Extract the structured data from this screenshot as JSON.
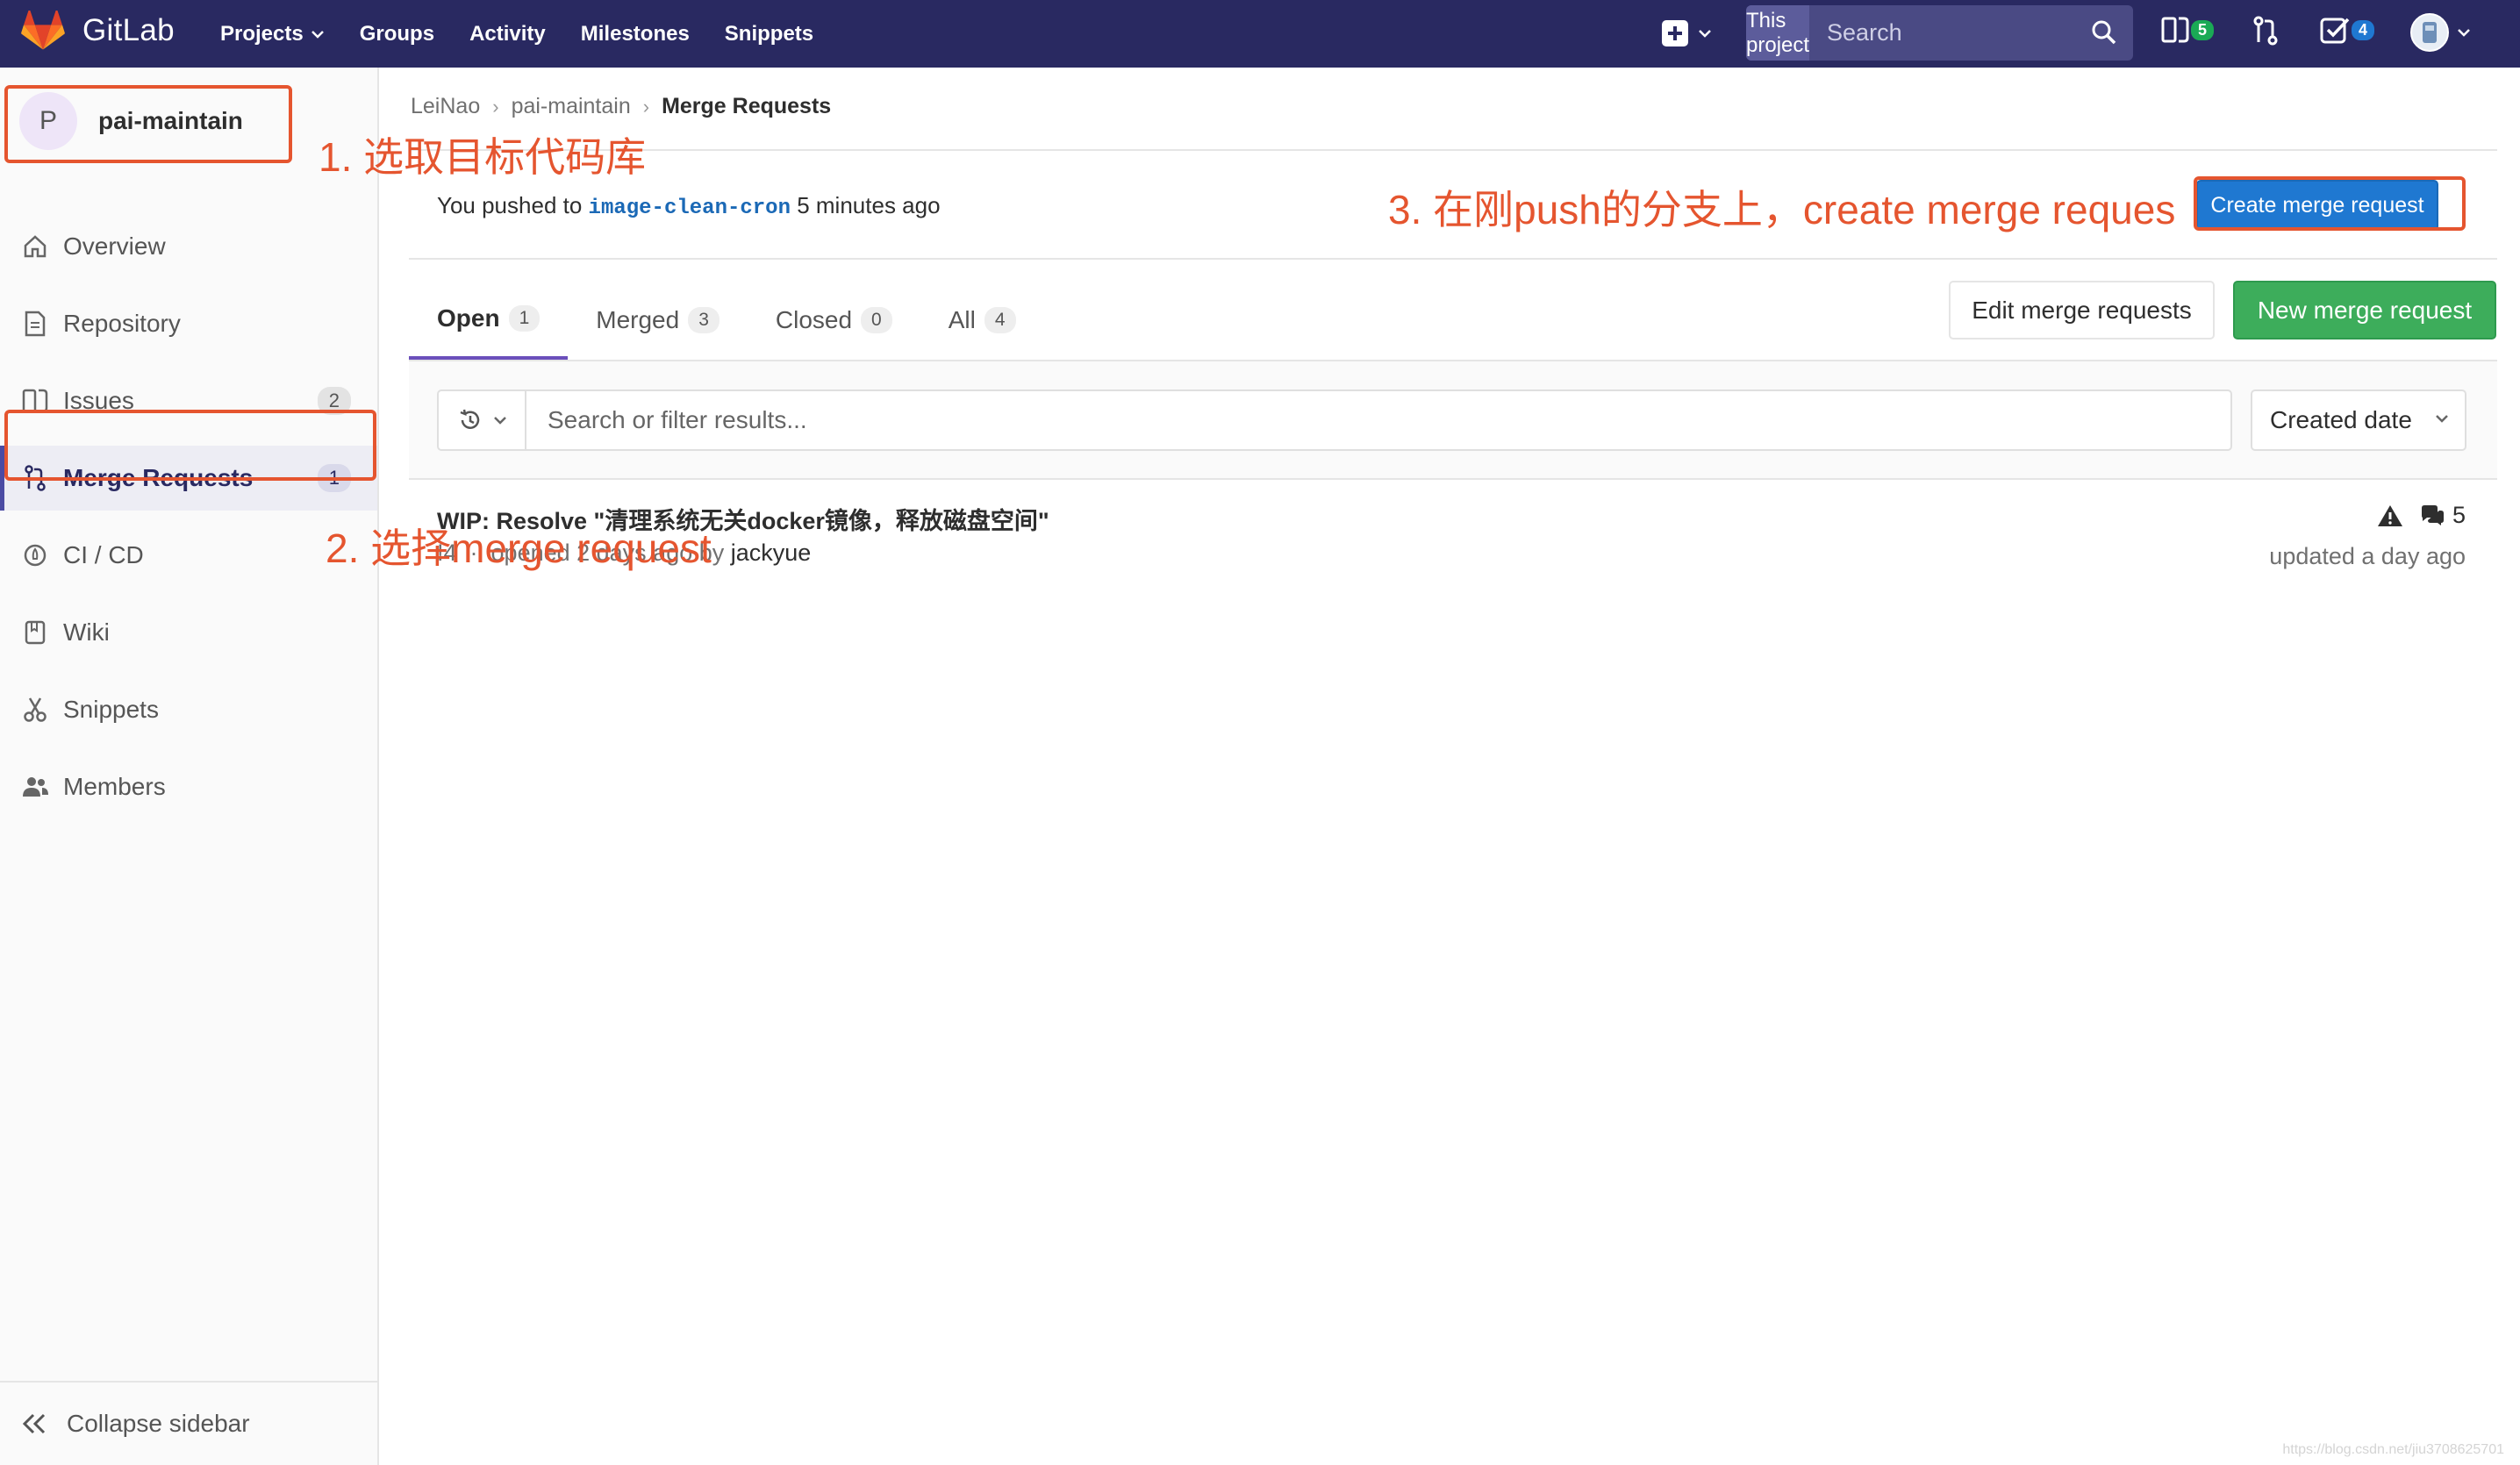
{
  "navbar": {
    "brand": "GitLab",
    "links": [
      "Projects",
      "Groups",
      "Activity",
      "Milestones",
      "Snippets"
    ],
    "search_scope": "This project",
    "search_placeholder": "Search",
    "issues_count": "5",
    "todos_count": "4",
    "bg_color": "#292961"
  },
  "sidebar": {
    "project_initial": "P",
    "project_name": "pai-maintain",
    "items": [
      {
        "label": "Overview",
        "icon": "home-icon"
      },
      {
        "label": "Repository",
        "icon": "doc-icon"
      },
      {
        "label": "Issues",
        "icon": "issues-icon",
        "count": "2"
      },
      {
        "label": "Merge Requests",
        "icon": "merge-request-icon",
        "count": "1",
        "active": true
      },
      {
        "label": "CI / CD",
        "icon": "rocket-icon"
      },
      {
        "label": "Wiki",
        "icon": "book-icon"
      },
      {
        "label": "Snippets",
        "icon": "scissors-icon"
      },
      {
        "label": "Members",
        "icon": "users-icon"
      }
    ],
    "collapse_label": "Collapse sidebar"
  },
  "breadcrumb": {
    "items": [
      "LeiNao",
      "pai-maintain"
    ],
    "current": "Merge Requests"
  },
  "push_notice": {
    "prefix": "You pushed to",
    "branch": "image-clean-cron",
    "suffix": "5 minutes ago",
    "create_button": "Create merge request"
  },
  "tabs": [
    {
      "label": "Open",
      "count": "1",
      "active": true
    },
    {
      "label": "Merged",
      "count": "3"
    },
    {
      "label": "Closed",
      "count": "0"
    },
    {
      "label": "All",
      "count": "4"
    }
  ],
  "actions": {
    "edit": "Edit merge requests",
    "new": "New merge request"
  },
  "filter": {
    "placeholder": "Search or filter results...",
    "sort": "Created date"
  },
  "merge_request": {
    "title": "WIP: Resolve \"清理系统无关docker镜像，释放磁盘空间\"",
    "ref": "!4",
    "opened": "opened 2 days ago by",
    "author": "jackyue",
    "comments": "5",
    "updated": "updated a day ago"
  },
  "annotations": {
    "step1": "1. 选取目标代码库",
    "step2": "2. 选择merge request",
    "step3": "3. 在刚push的分支上，create merge reques",
    "color": "#e5552f"
  },
  "watermark": "https://blog.csdn.net/jiu3708625701"
}
